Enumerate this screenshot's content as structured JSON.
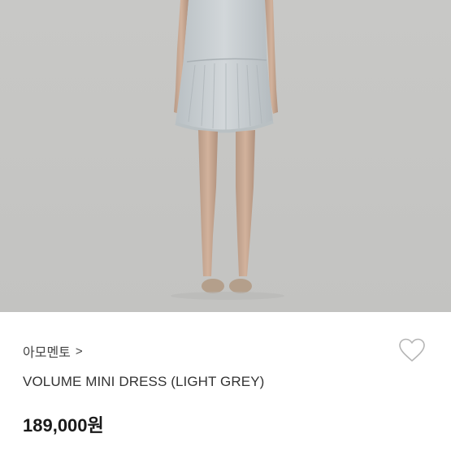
{
  "product_image": {
    "alt_semantic": "model-wearing-dress-photo"
  },
  "brand": {
    "name": "아모멘토",
    "chevron": ">"
  },
  "favorite": {
    "icon": "heart-outline-icon",
    "color": "#b5b5b5"
  },
  "product": {
    "name": "VOLUME MINI DRESS (LIGHT GREY)"
  },
  "price": {
    "value": "189,000원"
  }
}
